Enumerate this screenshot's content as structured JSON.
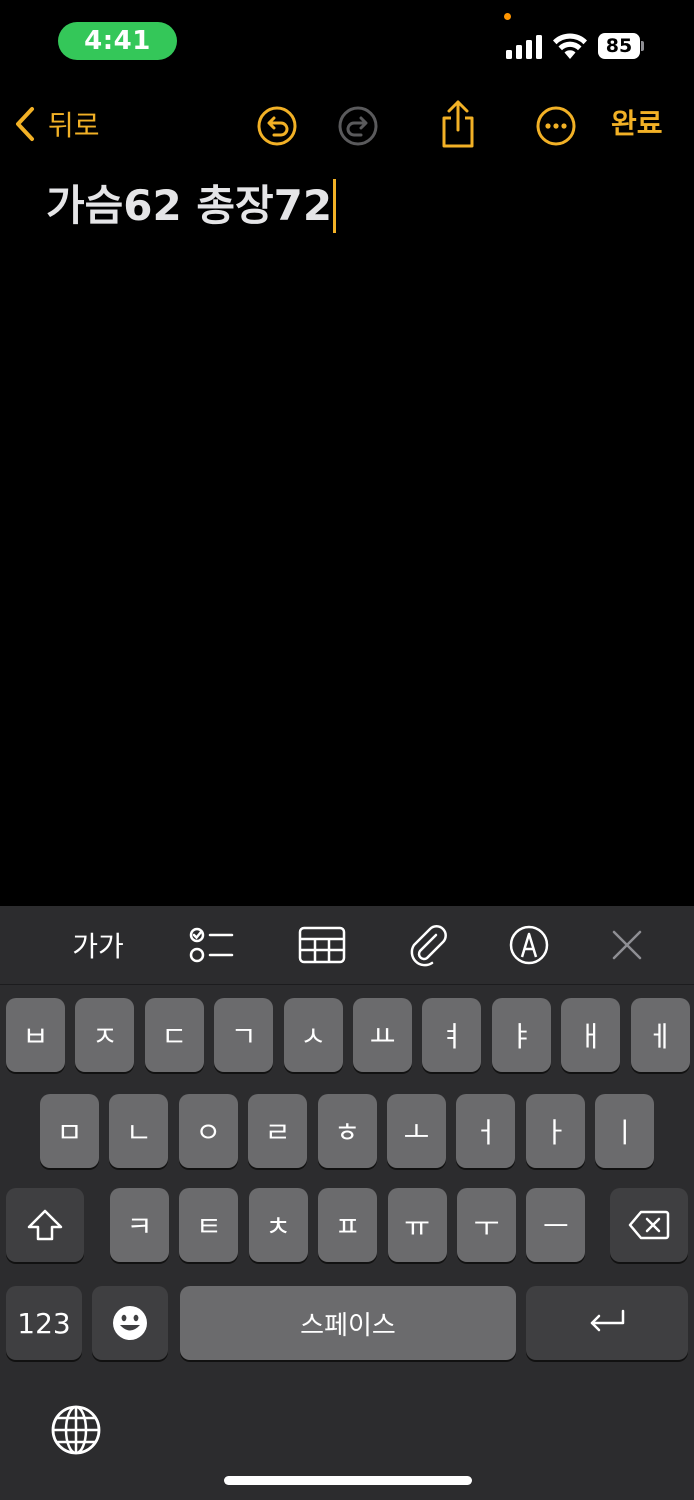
{
  "status_bar": {
    "time": "4:41",
    "battery": "85",
    "accent": "#34c759"
  },
  "nav": {
    "back_label": "뒤로",
    "done_label": "완료",
    "accent": "#f2b126",
    "icons": [
      "undo-icon",
      "redo-icon",
      "share-icon",
      "more-icon"
    ]
  },
  "note": {
    "text": "가슴62 총장72"
  },
  "toolbar": {
    "format_label": "가가",
    "icons": [
      "checklist-icon",
      "table-icon",
      "attachment-icon",
      "markup-icon",
      "close-icon"
    ]
  },
  "keyboard": {
    "row1": [
      "ㅂ",
      "ㅈ",
      "ㄷ",
      "ㄱ",
      "ㅅ",
      "ㅛ",
      "ㅕ",
      "ㅑ",
      "ㅐ",
      "ㅔ"
    ],
    "row2": [
      "ㅁ",
      "ㄴ",
      "ㅇ",
      "ㄹ",
      "ㅎ",
      "ㅗ",
      "ㅓ",
      "ㅏ",
      "ㅣ"
    ],
    "row3": [
      "ㅋ",
      "ㅌ",
      "ㅊ",
      "ㅍ",
      "ㅠ",
      "ㅜ",
      "ㅡ"
    ],
    "numbers_label": "123",
    "space_label": "스페이스"
  }
}
